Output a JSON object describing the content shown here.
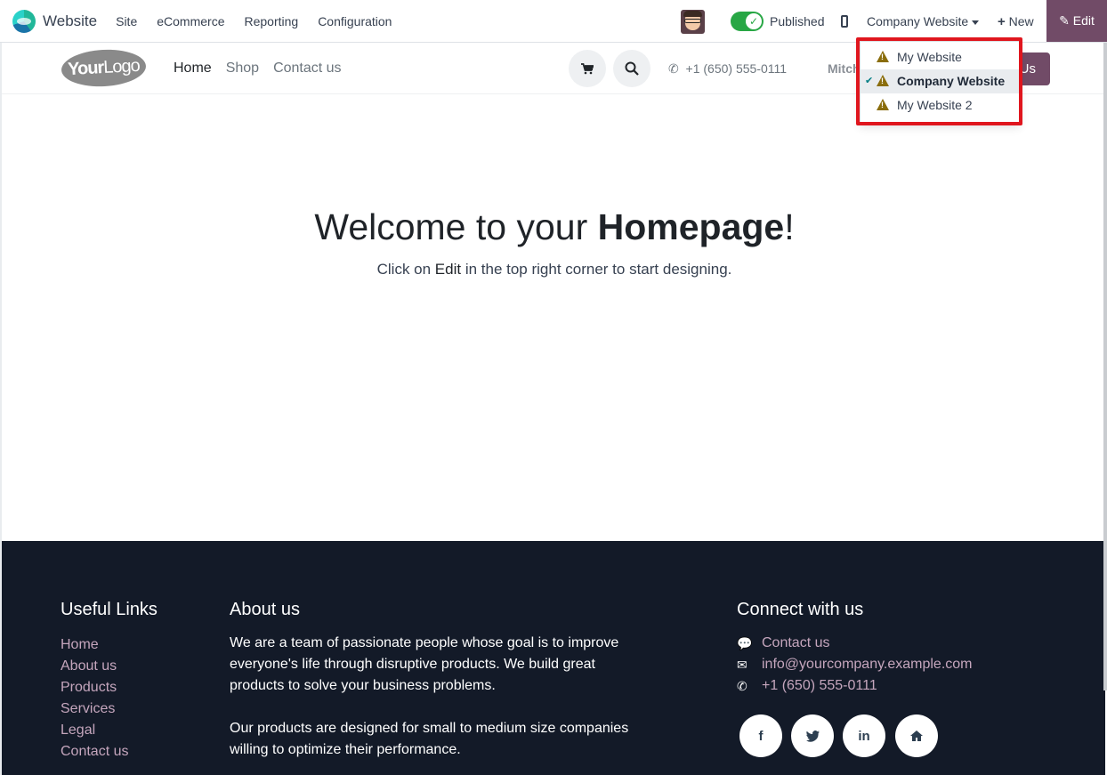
{
  "topbar": {
    "app_name": "Website",
    "menu": [
      "Site",
      "eCommerce",
      "Reporting",
      "Configuration"
    ],
    "published_label": "Published",
    "website_switch": "Company Website",
    "new_label": "New",
    "edit_label": "Edit"
  },
  "website_dropdown": {
    "items": [
      {
        "label": "My Website",
        "active": false
      },
      {
        "label": "Company Website",
        "active": true
      },
      {
        "label": "My Website 2",
        "active": false
      }
    ]
  },
  "site_header": {
    "logo_text_bold": "Your",
    "logo_text": "Logo",
    "nav": [
      "Home",
      "Shop",
      "Contact us"
    ],
    "phone": "+1 (650) 555-0111",
    "user_partial": "Mitch",
    "contact_btn_partial": "Us"
  },
  "hero": {
    "title_prefix": "Welcome to your ",
    "title_bold": "Homepage",
    "title_suffix": "!",
    "sub_prefix": "Click on ",
    "sub_edit": "Edit",
    "sub_suffix": " in the top right corner to start designing."
  },
  "footer": {
    "useful_links_title": "Useful Links",
    "useful_links": [
      "Home",
      "About us",
      "Products",
      "Services",
      "Legal",
      "Contact us"
    ],
    "about_title": "About us",
    "about_p1": "We are a team of passionate people whose goal is to improve everyone's life through disruptive products. We build great products to solve your business problems.",
    "about_p2": "Our products are designed for small to medium size companies willing to optimize their performance.",
    "connect_title": "Connect with us",
    "connect_contact": "Contact us",
    "connect_email": "info@yourcompany.example.com",
    "connect_phone": "+1 (650) 555-0111",
    "social_icons": [
      "facebook-icon",
      "twitter-icon",
      "linkedin-icon",
      "home-icon"
    ]
  },
  "colors": {
    "brand": "#714b67",
    "footer_bg": "#131a28",
    "footer_link": "#c5a6bd",
    "toggle_on": "#28a745",
    "highlight": "#e0161e"
  }
}
